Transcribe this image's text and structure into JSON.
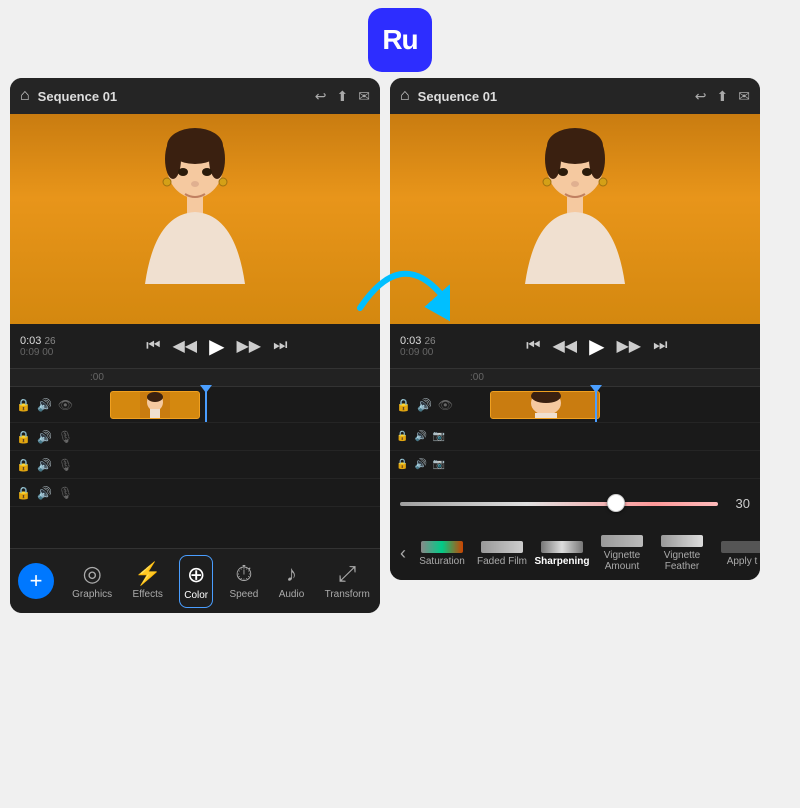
{
  "app": {
    "logo_text": "Ru",
    "bg_color": "#2d2dff"
  },
  "left_panel": {
    "header": {
      "home_icon": "⌂",
      "title": "Sequence 01",
      "undo_icon": "↩",
      "share_icon": "⬆",
      "chat_icon": "💬"
    },
    "playback": {
      "time_current": "0:03",
      "time_frames": "26",
      "time_total": "0:09",
      "time_total_frames": "00",
      "skip_back_icon": "⏮",
      "step_back_icon": "⏪",
      "play_icon": "▶",
      "step_forward_icon": "⏩",
      "skip_forward_icon": "⏭"
    },
    "timeline": {
      "ruler_label": ":00",
      "track1_icons": [
        "🔒",
        "🔊",
        "👁"
      ],
      "track2_icons": [
        "🔒",
        "🔊",
        "🎙"
      ],
      "track3_icons": [
        "🔒",
        "🔊",
        "🎙"
      ],
      "track4_icons": [
        "🔒",
        "🔊",
        "🎙"
      ]
    },
    "toolbar": {
      "add_btn": "+",
      "items": [
        {
          "label": "Graphics",
          "icon": "◎",
          "active": false
        },
        {
          "label": "Effects",
          "icon": "⚡",
          "active": false
        },
        {
          "label": "Color",
          "icon": "🎨",
          "active": true
        },
        {
          "label": "Speed",
          "icon": "⏱",
          "active": false
        },
        {
          "label": "Audio",
          "icon": "🎵",
          "active": false
        },
        {
          "label": "Transform",
          "icon": "⤢",
          "active": false
        }
      ]
    }
  },
  "right_panel": {
    "header": {
      "home_icon": "⌂",
      "title": "Sequence 01",
      "undo_icon": "↩",
      "share_icon": "⬆",
      "chat_icon": "💬"
    },
    "playback": {
      "time_current": "0:03",
      "time_frames": "26",
      "time_total": "0:09",
      "time_total_frames": "00"
    },
    "color_slider": {
      "value": "30"
    },
    "color_tabs": [
      {
        "label": "Saturation",
        "active": false
      },
      {
        "label": "Faded Film",
        "active": false
      },
      {
        "label": "Sharpening",
        "active": true
      },
      {
        "label": "Vignette Amount",
        "active": false
      },
      {
        "label": "Vignette Feather",
        "active": false
      },
      {
        "label": "Apply t",
        "active": false
      }
    ]
  }
}
